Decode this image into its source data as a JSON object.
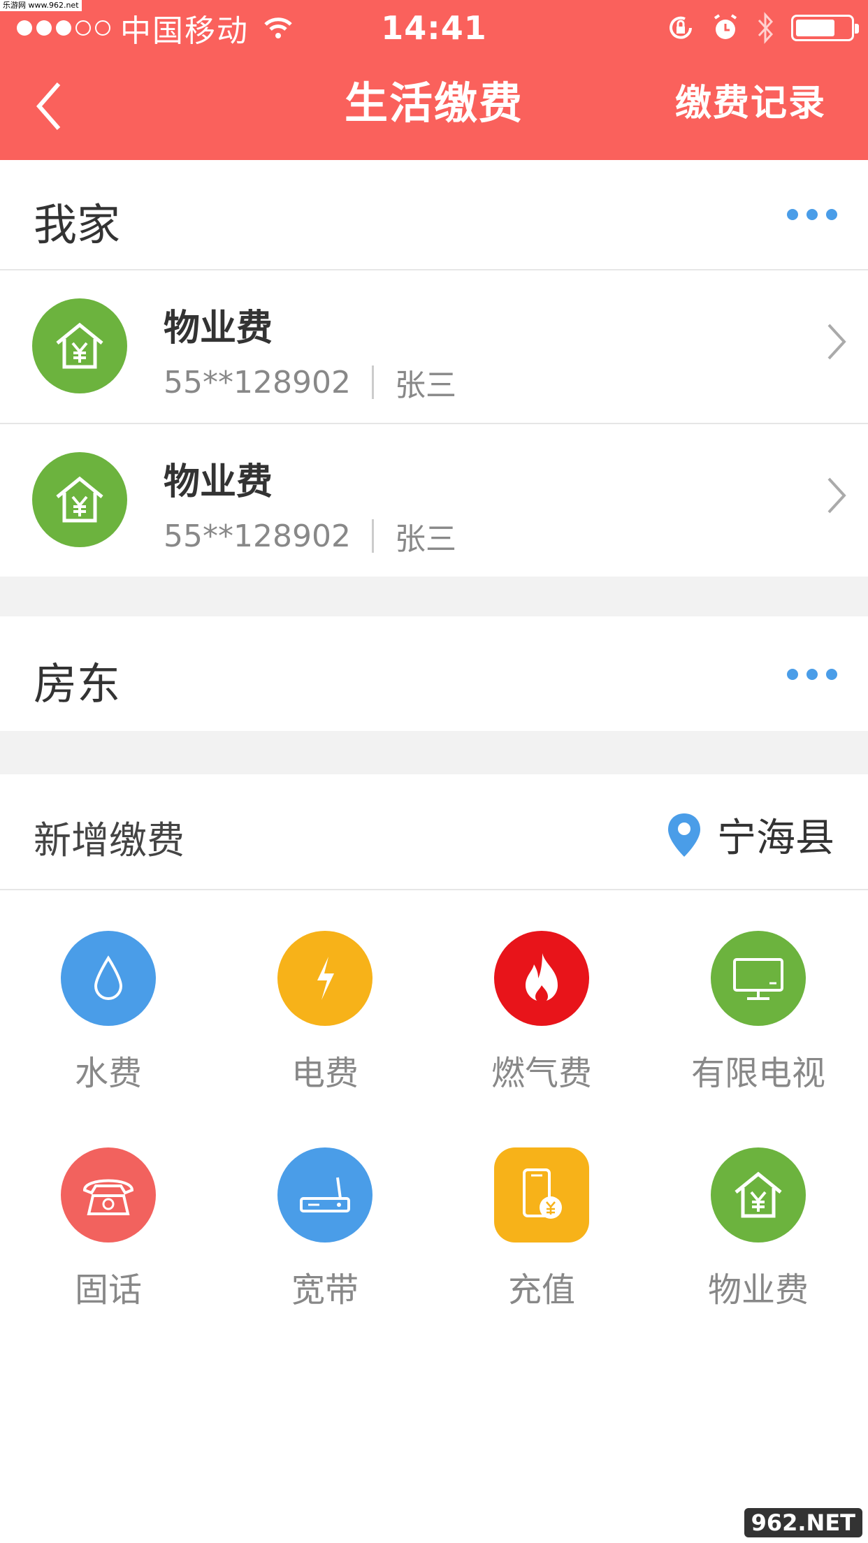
{
  "watermark": "乐游网 www.962.net",
  "status_bar": {
    "carrier": "中国移动",
    "time": "14:41"
  },
  "nav": {
    "title": "生活缴费",
    "right_label": "缴费记录"
  },
  "groups": [
    {
      "title": "我家",
      "bills": [
        {
          "name": "物业费",
          "account": "55**128902",
          "holder": "张三"
        },
        {
          "name": "物业费",
          "account": "55**128902",
          "holder": "张三"
        }
      ]
    },
    {
      "title": "房东",
      "bills": []
    }
  ],
  "add_section": {
    "title": "新增缴费",
    "location": "宁海县"
  },
  "services": [
    {
      "label": "水费",
      "icon": "water-drop-icon",
      "color": "#4a9de8"
    },
    {
      "label": "电费",
      "icon": "lightning-icon",
      "color": "#f7b219"
    },
    {
      "label": "燃气费",
      "icon": "flame-icon",
      "color": "#e8141a"
    },
    {
      "label": "有限电视",
      "icon": "tv-icon",
      "color": "#6cb33e"
    },
    {
      "label": "固话",
      "icon": "telephone-icon",
      "color": "#f2625e"
    },
    {
      "label": "宽带",
      "icon": "router-icon",
      "color": "#4a9de8"
    },
    {
      "label": "充值",
      "icon": "phone-recharge-icon",
      "color": "#f7b219"
    },
    {
      "label": "物业费",
      "icon": "house-yen-icon",
      "color": "#6cb33e"
    }
  ],
  "footer_logo": "962.NET"
}
